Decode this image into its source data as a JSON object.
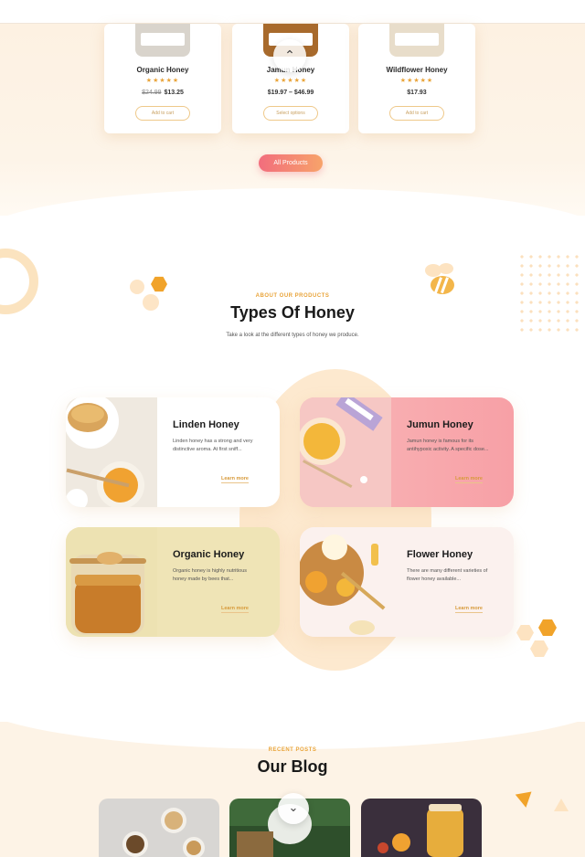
{
  "products": [
    {
      "name": "Organic Honey",
      "stars": "★★★★★",
      "old_price": "$24.99",
      "price": "$13.25",
      "button": "Add to cart"
    },
    {
      "name": "Jamun Honey",
      "stars": "★★★★★",
      "old_price": "",
      "price": "$19.97 – $46.99",
      "button": "Select options"
    },
    {
      "name": "Wildflower Honey",
      "stars": "★★★★★",
      "old_price": "",
      "price": "$17.93",
      "button": "Add to cart"
    }
  ],
  "all_products_label": "All Products",
  "scroll_top_icon": "chevron-up-icon",
  "about": {
    "eyebrow": "ABOUT OUR PRODUCTS",
    "title": "Types Of Honey",
    "subtitle": "Take a look at the different types of honey we produce."
  },
  "honey_types": [
    {
      "title": "Linden Honey",
      "desc": "Linden honey has a strong and very distinctive aroma. At first sniff...",
      "link": "Learn more"
    },
    {
      "title": "Jumun Honey",
      "desc": "Jamun honey is famous for its antihypoxic activity. A specific dose...",
      "link": "Learn more"
    },
    {
      "title": "Organic Honey",
      "desc": "Organic honey is highly nutritious honey made by bees that...",
      "link": "Learn more"
    },
    {
      "title": "Flower Honey",
      "desc": "There are many different varieties of flower honey available...",
      "link": "Learn more"
    }
  ],
  "blog": {
    "eyebrow": "RECENT POSTS",
    "title": "Our Blog"
  },
  "colors": {
    "accent": "#f1a32a",
    "cream": "#fdf3e6",
    "pink": "#f7a0a6",
    "button_gradient_start": "#f26d7d",
    "button_gradient_end": "#f7a36a"
  }
}
